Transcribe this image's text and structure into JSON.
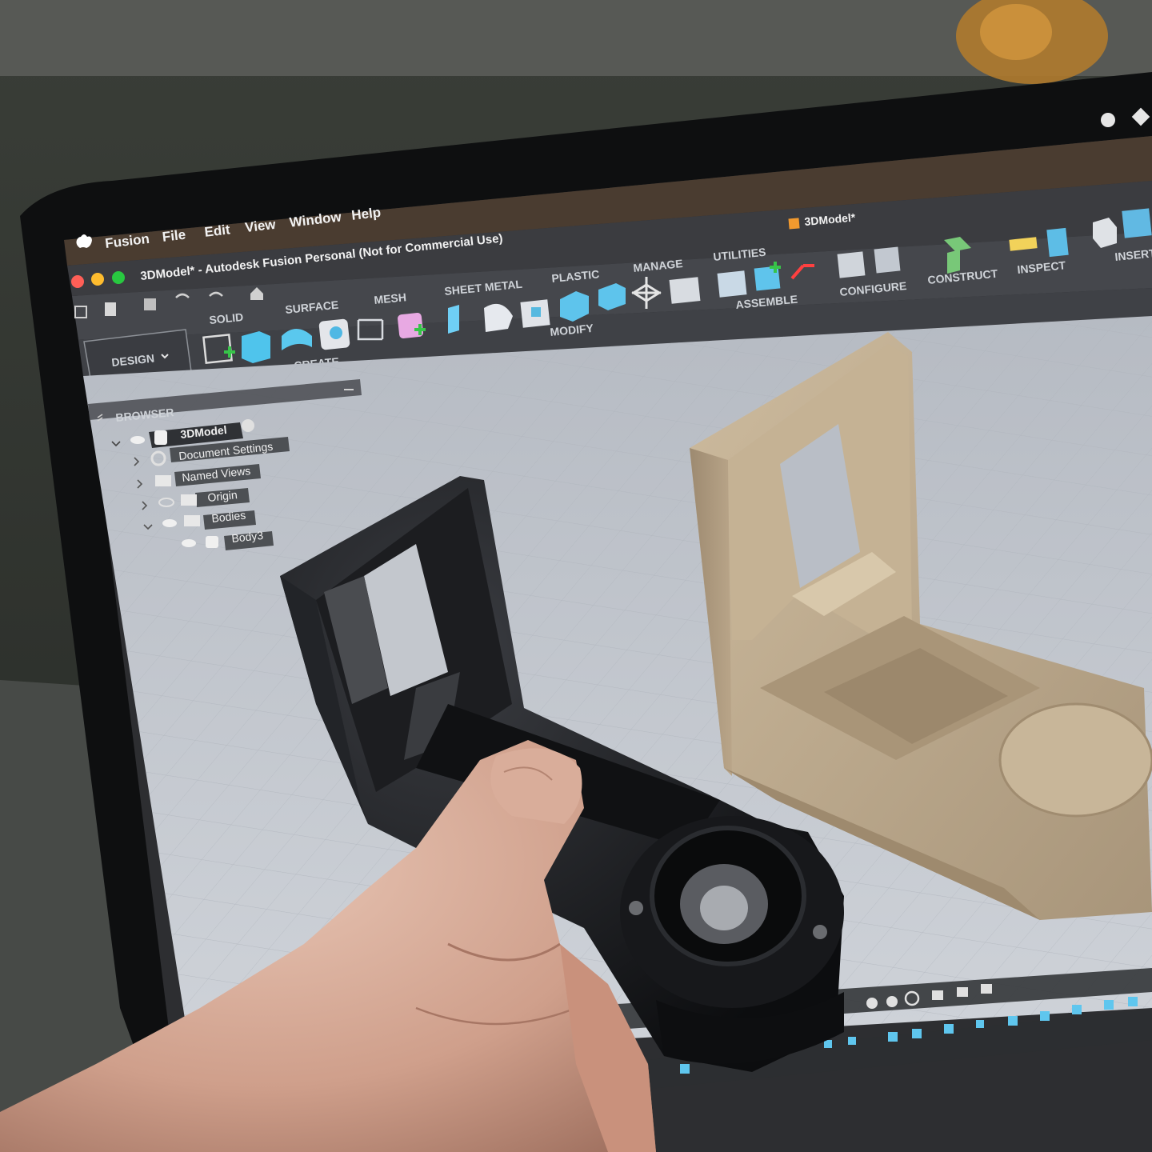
{
  "menubar": {
    "app": "Fusion",
    "items": [
      "File",
      "Edit",
      "View",
      "Window",
      "Help"
    ]
  },
  "window": {
    "title": "3DModel* - Autodesk Fusion Personal (Not for Commercial Use)",
    "tab": "3DModel*"
  },
  "workspace": {
    "label": "DESIGN"
  },
  "ribbon": {
    "tabs": [
      "SOLID",
      "SURFACE",
      "MESH",
      "SHEET METAL",
      "PLASTIC",
      "MANAGE",
      "UTILITIES"
    ],
    "groups": [
      "CREATE",
      "MODIFY",
      "ASSEMBLE",
      "CONFIGURE",
      "CONSTRUCT",
      "INSPECT",
      "INSERT"
    ]
  },
  "browser": {
    "title": "BROWSER",
    "items": [
      {
        "label": "3DModel",
        "icon": "document-icon"
      },
      {
        "label": "Document Settings",
        "icon": "gear-icon"
      },
      {
        "label": "Named Views",
        "icon": "folder-icon"
      },
      {
        "label": "Origin",
        "icon": "folder-icon"
      },
      {
        "label": "Bodies",
        "icon": "folder-icon"
      },
      {
        "label": "Body3",
        "icon": "body-icon"
      }
    ]
  },
  "colors": {
    "toolbar": "#4a4d52",
    "viewport": "#c8ccd2",
    "model": "#b8a487",
    "printed_part": "#151618"
  }
}
